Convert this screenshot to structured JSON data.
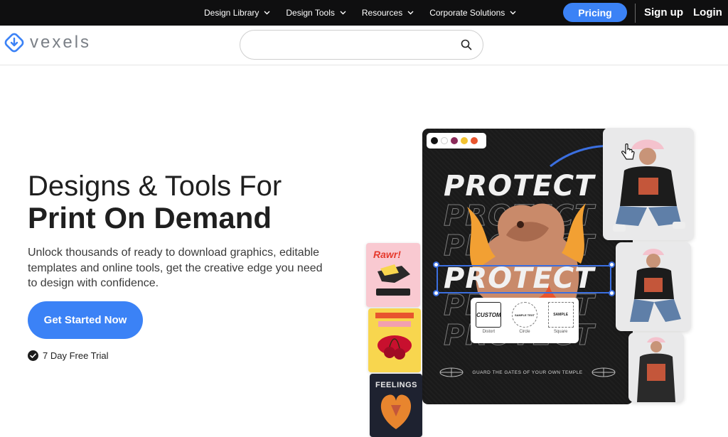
{
  "topnav": {
    "items": [
      {
        "label": "Design Library"
      },
      {
        "label": "Design Tools"
      },
      {
        "label": "Resources"
      },
      {
        "label": "Corporate Solutions"
      }
    ],
    "pricing": "Pricing",
    "signup": "Sign up",
    "login": "Login"
  },
  "header": {
    "logo_text": "vexels",
    "search": {
      "value": "",
      "placeholder": ""
    }
  },
  "hero": {
    "title_line1": "Designs & Tools For",
    "title_line2": "Print On Demand",
    "description": "Unlock thousands of ready to download graphics, editable templates and online tools, get the creative edge you need to design with confidence.",
    "cta": "Get Started Now",
    "trial": "7 Day Free Trial"
  },
  "illustration": {
    "poster_word": "PROTECT",
    "palette_colors": [
      "#111111",
      "#ffffff",
      "#8b2a5a",
      "#f2c230",
      "#e8552e"
    ],
    "warp_options": [
      {
        "label": "Distort",
        "sample": "CUSTOM"
      },
      {
        "label": "Circle",
        "sample": "SAMPLE TEXT"
      },
      {
        "label": "Square",
        "sample": "SAMPLE"
      }
    ],
    "tagline": "GUARD THE GATES OF YOUR OWN TEMPLE",
    "thumb_texts": [
      "Rawr!",
      "FEELINGS"
    ],
    "colors": {
      "accent": "#3b82f6",
      "topbar": "#0f0f10"
    }
  }
}
